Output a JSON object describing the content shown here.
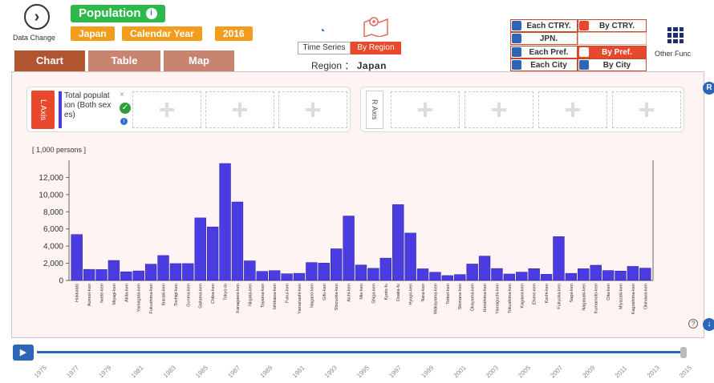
{
  "header": {
    "data_change_label": "Data Change",
    "title": "Population",
    "chips": [
      "Japan",
      "Calendar Year",
      "2016"
    ],
    "time_series_label": "Time Series",
    "by_region_label": "By Region",
    "region_prefix": "Region ：",
    "region_value": "Japan"
  },
  "region_buttons": {
    "row1": [
      "Each CTRY.",
      "By CTRY."
    ],
    "row2": [
      "JPN.",
      ""
    ],
    "row3": [
      "Each Pref.",
      "By Pref."
    ],
    "row4": [
      "Each City",
      "By City"
    ]
  },
  "other_func_label": "Other Func",
  "tabs": [
    "Chart",
    "Table",
    "Map"
  ],
  "axis": {
    "left_label": "L Axis",
    "right_label": "R Axis",
    "series_name": "Total population (Both sexes)",
    "series_name_lines": [
      "Total populat",
      "ion (Both sex",
      "es)"
    ],
    "close_mark": "×"
  },
  "colors": {
    "bar": "#4a3ce0",
    "accent": "#e8482b",
    "green": "#2eb84a",
    "orange": "#f29d1c",
    "blue": "#2c66b8"
  },
  "chart_data": {
    "type": "bar",
    "ylabel": "[ 1,000 persons ]",
    "ylim": [
      0,
      14000
    ],
    "yticks": [
      0,
      2000,
      4000,
      6000,
      8000,
      10000,
      12000
    ],
    "categories": [
      "Hokkaido",
      "Aomori-ken",
      "Iwate-ken",
      "Miyagi-ken",
      "Akita-ken",
      "Yamagata-ken",
      "Fukushima-ken",
      "Ibaraki-ken",
      "Tochigi-ken",
      "Gunma-ken",
      "Saitama-ken",
      "Chiba-ken",
      "Tokyo-to",
      "Kanagawa-ken",
      "Niigata-ken",
      "Toyama-ken",
      "Ishikawa-ken",
      "Fukui-ken",
      "Yamanashi-ken",
      "Nagano-ken",
      "Gifu-ken",
      "Shizuoka-ken",
      "Aichi-ken",
      "Mie-ken",
      "Shiga-ken",
      "Kyoto-fu",
      "Osaka-fu",
      "Hyogo-ken",
      "Nara-ken",
      "Wakayama-ken",
      "Tottori-ken",
      "Shimane-ken",
      "Okayama-ken",
      "Hiroshima-ken",
      "Yamaguchi-ken",
      "Tokushima-ken",
      "Kagawa-ken",
      "Ehime-ken",
      "Kochi-ken",
      "Fukuoka-ken",
      "Saga-ken",
      "Nagasaki-ken",
      "Kumamoto-ken",
      "Oita-ken",
      "Miyazaki-ken",
      "Kagoshima-ken",
      "Okinawa-ken"
    ],
    "values": [
      5352,
      1293,
      1268,
      2330,
      1010,
      1113,
      1901,
      2905,
      1966,
      1967,
      7289,
      6236,
      13624,
      9145,
      2286,
      1061,
      1151,
      782,
      830,
      2088,
      2022,
      3688,
      7507,
      1800,
      1413,
      2605,
      8833,
      5520,
      1356,
      954,
      570,
      690,
      1915,
      2837,
      1394,
      750,
      972,
      1375,
      721,
      5104,
      828,
      1367,
      1774,
      1160,
      1096,
      1637,
      1439
    ],
    "ticks_visible_text": "numeric y labels",
    "grid": false
  },
  "timeline": {
    "years": [
      "1975",
      "1977",
      "1979",
      "1981",
      "1983",
      "1985",
      "1987",
      "1989",
      "1991",
      "1993",
      "1995",
      "1997",
      "1999",
      "2001",
      "2003",
      "2005",
      "2007",
      "2009",
      "2011",
      "2013",
      "2015"
    ]
  },
  "icons": {
    "data_change": "chevron-right-circle-icon",
    "info": "info-icon",
    "time_series": "clock-icon",
    "map": "map-pin-icon",
    "other_func": "grid-icon",
    "check": "check-circle-icon",
    "play": "play-icon",
    "help": "help-icon"
  }
}
